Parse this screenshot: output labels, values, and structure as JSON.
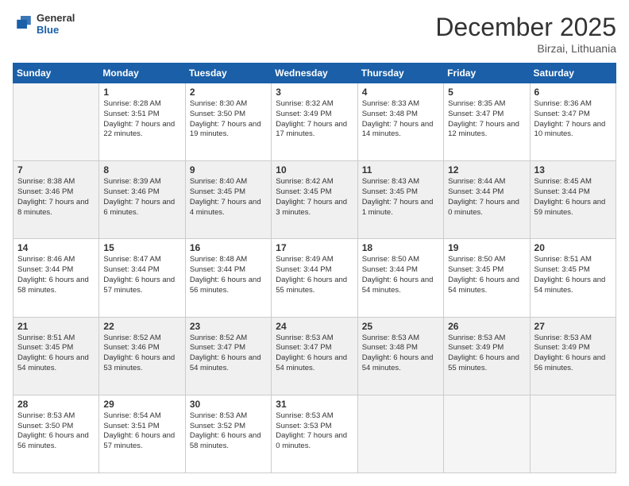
{
  "logo": {
    "general": "General",
    "blue": "Blue"
  },
  "title": "December 2025",
  "location": "Birzai, Lithuania",
  "days_of_week": [
    "Sunday",
    "Monday",
    "Tuesday",
    "Wednesday",
    "Thursday",
    "Friday",
    "Saturday"
  ],
  "weeks": [
    [
      {
        "day": "",
        "sunrise": "",
        "sunset": "",
        "daylight": ""
      },
      {
        "day": "1",
        "sunrise": "Sunrise: 8:28 AM",
        "sunset": "Sunset: 3:51 PM",
        "daylight": "Daylight: 7 hours and 22 minutes."
      },
      {
        "day": "2",
        "sunrise": "Sunrise: 8:30 AM",
        "sunset": "Sunset: 3:50 PM",
        "daylight": "Daylight: 7 hours and 19 minutes."
      },
      {
        "day": "3",
        "sunrise": "Sunrise: 8:32 AM",
        "sunset": "Sunset: 3:49 PM",
        "daylight": "Daylight: 7 hours and 17 minutes."
      },
      {
        "day": "4",
        "sunrise": "Sunrise: 8:33 AM",
        "sunset": "Sunset: 3:48 PM",
        "daylight": "Daylight: 7 hours and 14 minutes."
      },
      {
        "day": "5",
        "sunrise": "Sunrise: 8:35 AM",
        "sunset": "Sunset: 3:47 PM",
        "daylight": "Daylight: 7 hours and 12 minutes."
      },
      {
        "day": "6",
        "sunrise": "Sunrise: 8:36 AM",
        "sunset": "Sunset: 3:47 PM",
        "daylight": "Daylight: 7 hours and 10 minutes."
      }
    ],
    [
      {
        "day": "7",
        "sunrise": "Sunrise: 8:38 AM",
        "sunset": "Sunset: 3:46 PM",
        "daylight": "Daylight: 7 hours and 8 minutes."
      },
      {
        "day": "8",
        "sunrise": "Sunrise: 8:39 AM",
        "sunset": "Sunset: 3:46 PM",
        "daylight": "Daylight: 7 hours and 6 minutes."
      },
      {
        "day": "9",
        "sunrise": "Sunrise: 8:40 AM",
        "sunset": "Sunset: 3:45 PM",
        "daylight": "Daylight: 7 hours and 4 minutes."
      },
      {
        "day": "10",
        "sunrise": "Sunrise: 8:42 AM",
        "sunset": "Sunset: 3:45 PM",
        "daylight": "Daylight: 7 hours and 3 minutes."
      },
      {
        "day": "11",
        "sunrise": "Sunrise: 8:43 AM",
        "sunset": "Sunset: 3:45 PM",
        "daylight": "Daylight: 7 hours and 1 minute."
      },
      {
        "day": "12",
        "sunrise": "Sunrise: 8:44 AM",
        "sunset": "Sunset: 3:44 PM",
        "daylight": "Daylight: 7 hours and 0 minutes."
      },
      {
        "day": "13",
        "sunrise": "Sunrise: 8:45 AM",
        "sunset": "Sunset: 3:44 PM",
        "daylight": "Daylight: 6 hours and 59 minutes."
      }
    ],
    [
      {
        "day": "14",
        "sunrise": "Sunrise: 8:46 AM",
        "sunset": "Sunset: 3:44 PM",
        "daylight": "Daylight: 6 hours and 58 minutes."
      },
      {
        "day": "15",
        "sunrise": "Sunrise: 8:47 AM",
        "sunset": "Sunset: 3:44 PM",
        "daylight": "Daylight: 6 hours and 57 minutes."
      },
      {
        "day": "16",
        "sunrise": "Sunrise: 8:48 AM",
        "sunset": "Sunset: 3:44 PM",
        "daylight": "Daylight: 6 hours and 56 minutes."
      },
      {
        "day": "17",
        "sunrise": "Sunrise: 8:49 AM",
        "sunset": "Sunset: 3:44 PM",
        "daylight": "Daylight: 6 hours and 55 minutes."
      },
      {
        "day": "18",
        "sunrise": "Sunrise: 8:50 AM",
        "sunset": "Sunset: 3:44 PM",
        "daylight": "Daylight: 6 hours and 54 minutes."
      },
      {
        "day": "19",
        "sunrise": "Sunrise: 8:50 AM",
        "sunset": "Sunset: 3:45 PM",
        "daylight": "Daylight: 6 hours and 54 minutes."
      },
      {
        "day": "20",
        "sunrise": "Sunrise: 8:51 AM",
        "sunset": "Sunset: 3:45 PM",
        "daylight": "Daylight: 6 hours and 54 minutes."
      }
    ],
    [
      {
        "day": "21",
        "sunrise": "Sunrise: 8:51 AM",
        "sunset": "Sunset: 3:45 PM",
        "daylight": "Daylight: 6 hours and 54 minutes."
      },
      {
        "day": "22",
        "sunrise": "Sunrise: 8:52 AM",
        "sunset": "Sunset: 3:46 PM",
        "daylight": "Daylight: 6 hours and 53 minutes."
      },
      {
        "day": "23",
        "sunrise": "Sunrise: 8:52 AM",
        "sunset": "Sunset: 3:47 PM",
        "daylight": "Daylight: 6 hours and 54 minutes."
      },
      {
        "day": "24",
        "sunrise": "Sunrise: 8:53 AM",
        "sunset": "Sunset: 3:47 PM",
        "daylight": "Daylight: 6 hours and 54 minutes."
      },
      {
        "day": "25",
        "sunrise": "Sunrise: 8:53 AM",
        "sunset": "Sunset: 3:48 PM",
        "daylight": "Daylight: 6 hours and 54 minutes."
      },
      {
        "day": "26",
        "sunrise": "Sunrise: 8:53 AM",
        "sunset": "Sunset: 3:49 PM",
        "daylight": "Daylight: 6 hours and 55 minutes."
      },
      {
        "day": "27",
        "sunrise": "Sunrise: 8:53 AM",
        "sunset": "Sunset: 3:49 PM",
        "daylight": "Daylight: 6 hours and 56 minutes."
      }
    ],
    [
      {
        "day": "28",
        "sunrise": "Sunrise: 8:53 AM",
        "sunset": "Sunset: 3:50 PM",
        "daylight": "Daylight: 6 hours and 56 minutes."
      },
      {
        "day": "29",
        "sunrise": "Sunrise: 8:54 AM",
        "sunset": "Sunset: 3:51 PM",
        "daylight": "Daylight: 6 hours and 57 minutes."
      },
      {
        "day": "30",
        "sunrise": "Sunrise: 8:53 AM",
        "sunset": "Sunset: 3:52 PM",
        "daylight": "Daylight: 6 hours and 58 minutes."
      },
      {
        "day": "31",
        "sunrise": "Sunrise: 8:53 AM",
        "sunset": "Sunset: 3:53 PM",
        "daylight": "Daylight: 7 hours and 0 minutes."
      },
      {
        "day": "",
        "sunrise": "",
        "sunset": "",
        "daylight": ""
      },
      {
        "day": "",
        "sunrise": "",
        "sunset": "",
        "daylight": ""
      },
      {
        "day": "",
        "sunrise": "",
        "sunset": "",
        "daylight": ""
      }
    ]
  ]
}
